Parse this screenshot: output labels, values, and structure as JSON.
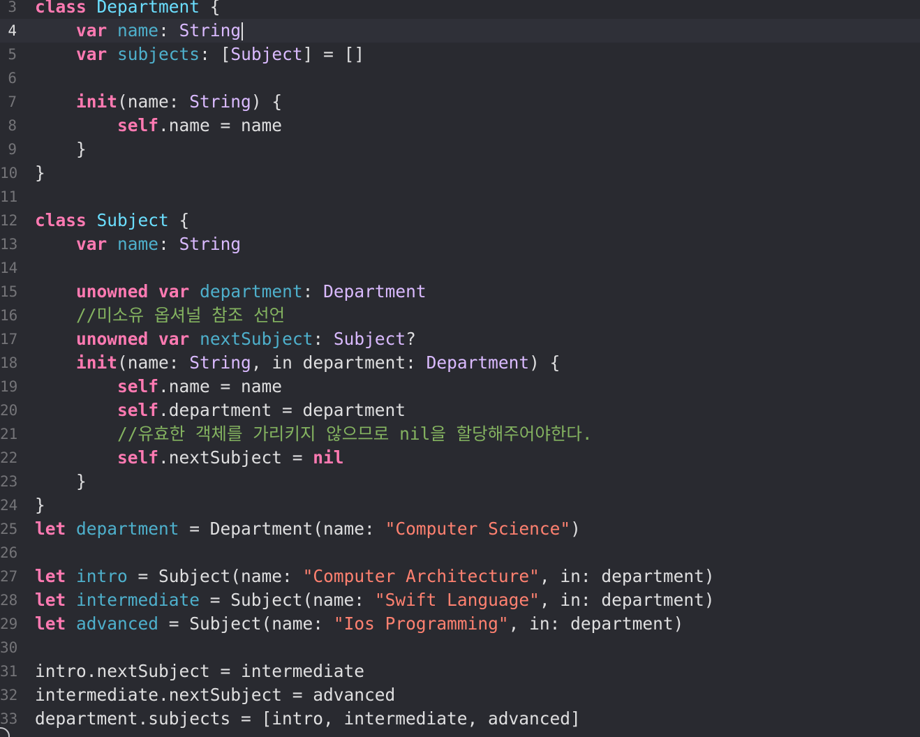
{
  "editor": {
    "current_line": "4",
    "lines": [
      {
        "num": "3",
        "tokens": [
          {
            "c": "kw",
            "t": "class"
          },
          {
            "c": "plain",
            "t": " "
          },
          {
            "c": "tdecl",
            "t": "Department"
          },
          {
            "c": "plain",
            "t": " {"
          }
        ]
      },
      {
        "num": "4",
        "tokens": [
          {
            "c": "plain",
            "t": "    "
          },
          {
            "c": "kw",
            "t": "var"
          },
          {
            "c": "plain",
            "t": " "
          },
          {
            "c": "vdecl",
            "t": "name"
          },
          {
            "c": "plain",
            "t": ": "
          },
          {
            "c": "type",
            "t": "String"
          }
        ]
      },
      {
        "num": "5",
        "tokens": [
          {
            "c": "plain",
            "t": "    "
          },
          {
            "c": "kw",
            "t": "var"
          },
          {
            "c": "plain",
            "t": " "
          },
          {
            "c": "vdecl",
            "t": "subjects"
          },
          {
            "c": "plain",
            "t": ": ["
          },
          {
            "c": "type",
            "t": "Subject"
          },
          {
            "c": "plain",
            "t": "] = []"
          }
        ]
      },
      {
        "num": "6",
        "tokens": []
      },
      {
        "num": "7",
        "tokens": [
          {
            "c": "plain",
            "t": "    "
          },
          {
            "c": "kw",
            "t": "init"
          },
          {
            "c": "plain",
            "t": "(name: "
          },
          {
            "c": "type",
            "t": "String"
          },
          {
            "c": "plain",
            "t": ") {"
          }
        ]
      },
      {
        "num": "8",
        "tokens": [
          {
            "c": "plain",
            "t": "        "
          },
          {
            "c": "kw",
            "t": "self"
          },
          {
            "c": "plain",
            "t": ".name = name"
          }
        ]
      },
      {
        "num": "9",
        "tokens": [
          {
            "c": "plain",
            "t": "    }"
          }
        ]
      },
      {
        "num": "10",
        "tokens": [
          {
            "c": "plain",
            "t": "}"
          }
        ]
      },
      {
        "num": "11",
        "tokens": []
      },
      {
        "num": "12",
        "tokens": [
          {
            "c": "kw",
            "t": "class"
          },
          {
            "c": "plain",
            "t": " "
          },
          {
            "c": "tdecl",
            "t": "Subject"
          },
          {
            "c": "plain",
            "t": " {"
          }
        ]
      },
      {
        "num": "13",
        "tokens": [
          {
            "c": "plain",
            "t": "    "
          },
          {
            "c": "kw",
            "t": "var"
          },
          {
            "c": "plain",
            "t": " "
          },
          {
            "c": "vdecl",
            "t": "name"
          },
          {
            "c": "plain",
            "t": ": "
          },
          {
            "c": "type",
            "t": "String"
          }
        ]
      },
      {
        "num": "14",
        "tokens": []
      },
      {
        "num": "15",
        "tokens": [
          {
            "c": "plain",
            "t": "    "
          },
          {
            "c": "kw",
            "t": "unowned"
          },
          {
            "c": "plain",
            "t": " "
          },
          {
            "c": "kw",
            "t": "var"
          },
          {
            "c": "plain",
            "t": " "
          },
          {
            "c": "vdecl",
            "t": "department"
          },
          {
            "c": "plain",
            "t": ": "
          },
          {
            "c": "type",
            "t": "Department"
          }
        ]
      },
      {
        "num": "16",
        "tokens": [
          {
            "c": "plain",
            "t": "    "
          },
          {
            "c": "cmt",
            "t": "//미소유 옵셔널 참조 선언"
          }
        ]
      },
      {
        "num": "17",
        "tokens": [
          {
            "c": "plain",
            "t": "    "
          },
          {
            "c": "kw",
            "t": "unowned"
          },
          {
            "c": "plain",
            "t": " "
          },
          {
            "c": "kw",
            "t": "var"
          },
          {
            "c": "plain",
            "t": " "
          },
          {
            "c": "vdecl",
            "t": "nextSubject"
          },
          {
            "c": "plain",
            "t": ": "
          },
          {
            "c": "type",
            "t": "Subject"
          },
          {
            "c": "plain",
            "t": "?"
          }
        ]
      },
      {
        "num": "18",
        "tokens": [
          {
            "c": "plain",
            "t": "    "
          },
          {
            "c": "kw",
            "t": "init"
          },
          {
            "c": "plain",
            "t": "(name: "
          },
          {
            "c": "type",
            "t": "String"
          },
          {
            "c": "plain",
            "t": ", in department: "
          },
          {
            "c": "type",
            "t": "Department"
          },
          {
            "c": "plain",
            "t": ") {"
          }
        ]
      },
      {
        "num": "19",
        "tokens": [
          {
            "c": "plain",
            "t": "        "
          },
          {
            "c": "kw",
            "t": "self"
          },
          {
            "c": "plain",
            "t": ".name = name"
          }
        ]
      },
      {
        "num": "20",
        "tokens": [
          {
            "c": "plain",
            "t": "        "
          },
          {
            "c": "kw",
            "t": "self"
          },
          {
            "c": "plain",
            "t": ".department = department"
          }
        ]
      },
      {
        "num": "21",
        "tokens": [
          {
            "c": "plain",
            "t": "        "
          },
          {
            "c": "cmt",
            "t": "//유효한 객체를 가리키지 않으므로 nil을 할당해주어야한다."
          }
        ]
      },
      {
        "num": "22",
        "tokens": [
          {
            "c": "plain",
            "t": "        "
          },
          {
            "c": "kw",
            "t": "self"
          },
          {
            "c": "plain",
            "t": ".nextSubject = "
          },
          {
            "c": "kw",
            "t": "nil"
          }
        ]
      },
      {
        "num": "23",
        "tokens": [
          {
            "c": "plain",
            "t": "    }"
          }
        ]
      },
      {
        "num": "24",
        "tokens": [
          {
            "c": "plain",
            "t": "}"
          }
        ]
      },
      {
        "num": "25",
        "tokens": [
          {
            "c": "kw",
            "t": "let"
          },
          {
            "c": "plain",
            "t": " "
          },
          {
            "c": "vdecl",
            "t": "department"
          },
          {
            "c": "plain",
            "t": " = Department(name: "
          },
          {
            "c": "str",
            "t": "\"Computer Science\""
          },
          {
            "c": "plain",
            "t": ")"
          }
        ]
      },
      {
        "num": "26",
        "tokens": []
      },
      {
        "num": "27",
        "tokens": [
          {
            "c": "kw",
            "t": "let"
          },
          {
            "c": "plain",
            "t": " "
          },
          {
            "c": "vdecl",
            "t": "intro"
          },
          {
            "c": "plain",
            "t": " = Subject(name: "
          },
          {
            "c": "str",
            "t": "\"Computer Architecture\""
          },
          {
            "c": "plain",
            "t": ", in: department)"
          }
        ]
      },
      {
        "num": "28",
        "tokens": [
          {
            "c": "kw",
            "t": "let"
          },
          {
            "c": "plain",
            "t": " "
          },
          {
            "c": "vdecl",
            "t": "intermediate"
          },
          {
            "c": "plain",
            "t": " = Subject(name: "
          },
          {
            "c": "str",
            "t": "\"Swift Language\""
          },
          {
            "c": "plain",
            "t": ", in: department)"
          }
        ]
      },
      {
        "num": "29",
        "tokens": [
          {
            "c": "kw",
            "t": "let"
          },
          {
            "c": "plain",
            "t": " "
          },
          {
            "c": "vdecl",
            "t": "advanced"
          },
          {
            "c": "plain",
            "t": " = Subject(name: "
          },
          {
            "c": "str",
            "t": "\"Ios Programming\""
          },
          {
            "c": "plain",
            "t": ", in: department)"
          }
        ]
      },
      {
        "num": "30",
        "tokens": []
      },
      {
        "num": "31",
        "tokens": [
          {
            "c": "plain",
            "t": "intro.nextSubject = intermediate"
          }
        ]
      },
      {
        "num": "32",
        "tokens": [
          {
            "c": "plain",
            "t": "intermediate.nextSubject = advanced"
          }
        ]
      },
      {
        "num": "33",
        "tokens": [
          {
            "c": "plain",
            "t": "department.subjects = [intro, intermediate, advanced]"
          }
        ]
      }
    ]
  }
}
